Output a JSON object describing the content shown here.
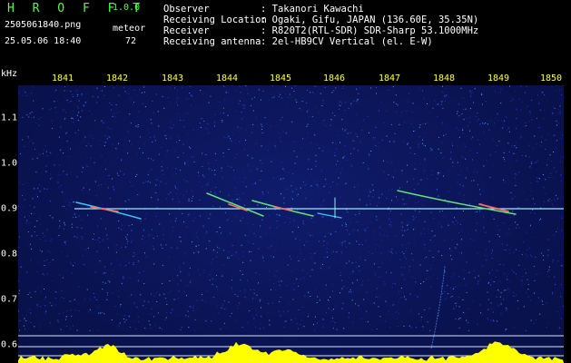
{
  "app": {
    "brand": "H R O F F T",
    "version": "1.0.0",
    "filename": "2505061840.png",
    "kind_label": "meteor",
    "datetime": "25.05.06 18:40",
    "count": "72"
  },
  "info": {
    "observer_label": "Observer",
    "observer_value": ": Takanori Kawachi",
    "location_label": "Receiving Location",
    "location_value": ": Ogaki, Gifu, JAPAN (136.60E, 35.35N)",
    "receiver_label": "Receiver",
    "receiver_value": ": R820T2(RTL-SDR) SDR-Sharp 53.1000MHz",
    "antenna_label": "Receiving antenna",
    "antenna_value": ": 2el-HB9CV Vertical (el. E-W)"
  },
  "axes": {
    "y_unit": "kHz",
    "x_ticks": [
      "1841",
      "1842",
      "1843",
      "1844",
      "1845",
      "1846",
      "1847",
      "1848",
      "1849",
      "1850"
    ],
    "y_ticks": [
      "1.1",
      "1.0",
      "0.9",
      "0.8",
      "0.7",
      "0.6"
    ]
  },
  "colors": {
    "label_green": "#4cff4c",
    "text_white": "#ffffff",
    "spectrum_bg": "#0b1455",
    "profile_yellow": "#ffff00",
    "carrier_line": "#9fe6ff"
  }
}
